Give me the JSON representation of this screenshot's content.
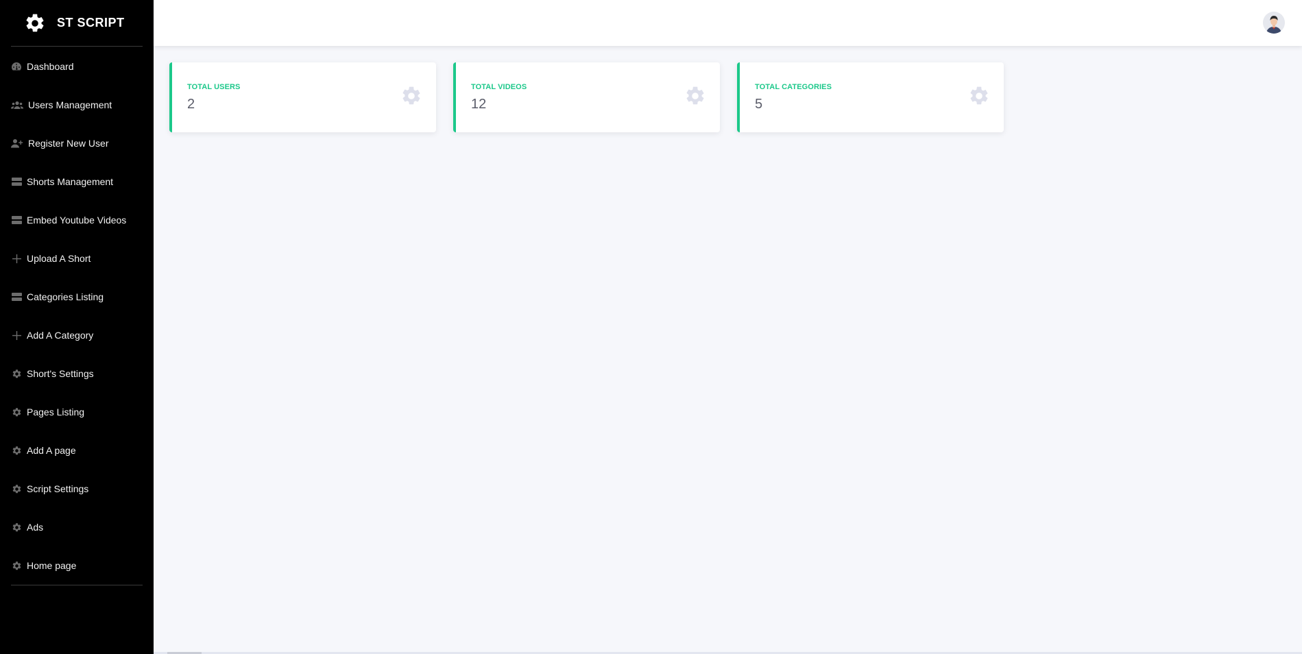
{
  "brand": {
    "title": "ST SCRIPT",
    "icon": "gear-icon"
  },
  "sidebar": {
    "items": [
      {
        "label": "Dashboard",
        "icon": "dashboard-icon"
      },
      {
        "label": "Users Management",
        "icon": "users-icon"
      },
      {
        "label": "Register New User",
        "icon": "user-plus-icon"
      },
      {
        "label": "Shorts Management",
        "icon": "list-icon"
      },
      {
        "label": "Embed Youtube Videos",
        "icon": "list-icon"
      },
      {
        "label": "Upload A Short",
        "icon": "plus-icon"
      },
      {
        "label": "Categories Listing",
        "icon": "list-icon"
      },
      {
        "label": "Add A Category",
        "icon": "plus-icon"
      },
      {
        "label": "Short's Settings",
        "icon": "gear-icon"
      },
      {
        "label": "Pages Listing",
        "icon": "gear-icon"
      },
      {
        "label": "Add A page",
        "icon": "gear-icon"
      },
      {
        "label": "Script Settings",
        "icon": "gear-icon"
      },
      {
        "label": "Ads",
        "icon": "gear-icon"
      },
      {
        "label": "Home page",
        "icon": "gear-icon"
      }
    ]
  },
  "topbar": {
    "avatar": "user-avatar"
  },
  "cards": [
    {
      "label": "TOTAL USERS",
      "value": "2",
      "icon": "gear-icon"
    },
    {
      "label": "TOTAL VIDEOS",
      "value": "12",
      "icon": "gear-icon"
    },
    {
      "label": "TOTAL CATEGORIES",
      "value": "5",
      "icon": "gear-icon"
    }
  ],
  "colors": {
    "accent": "#1cc88a",
    "sidebar": "#000000",
    "background": "#f6f7fb",
    "card_icon": "#dddfeb"
  }
}
